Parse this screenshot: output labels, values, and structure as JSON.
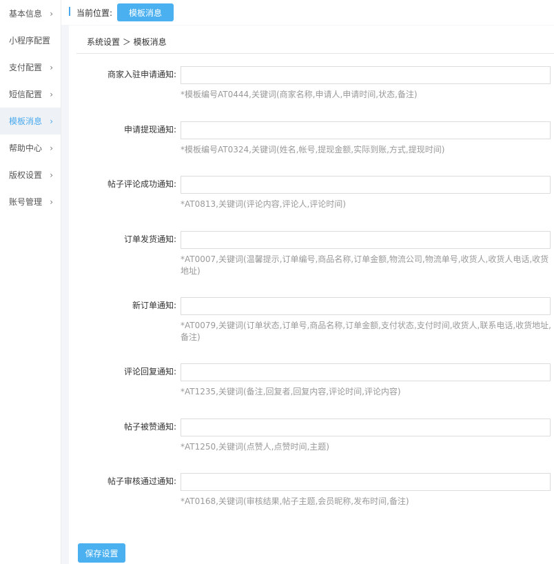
{
  "sidebar": {
    "items": [
      {
        "label": "基本信息",
        "chevron": "›"
      },
      {
        "label": "小程序配置",
        "chevron": ""
      },
      {
        "label": "支付配置",
        "chevron": "›"
      },
      {
        "label": "短信配置",
        "chevron": "›"
      },
      {
        "label": "模板消息",
        "chevron": "›",
        "active": true
      },
      {
        "label": "帮助中心",
        "chevron": "›"
      },
      {
        "label": "版权设置",
        "chevron": "›"
      },
      {
        "label": "账号管理",
        "chevron": "›"
      }
    ]
  },
  "topbar": {
    "location_label": "当前位置:",
    "location_button": "模板消息"
  },
  "breadcrumb": "系统设置 ＞ 模板消息",
  "fields": [
    {
      "label": "商家入驻申请通知:",
      "value": "",
      "hint": "*模板编号AT0444,关键词(商家名称,申请人,申请时间,状态,备注)"
    },
    {
      "label": "申请提现通知:",
      "value": "",
      "hint": "*模板编号AT0324,关键词(姓名,帐号,提现金额,实际到账,方式,提现时间)"
    },
    {
      "label": "帖子评论成功通知:",
      "value": "",
      "hint": "*AT0813,关键词(评论内容,评论人,评论时间)"
    },
    {
      "label": "订单发货通知:",
      "value": "",
      "hint": "*AT0007,关键词(温馨提示,订单编号,商品名称,订单金额,物流公司,物流单号,收货人,收货人电话,收货地址)"
    },
    {
      "label": "新订单通知:",
      "value": "",
      "hint": "*AT0079,关键词(订单状态,订单号,商品名称,订单金额,支付状态,支付时间,收货人,联系电话,收货地址,备注)"
    },
    {
      "label": "评论回复通知:",
      "value": "",
      "hint": "*AT1235,关键词(备注,回复者,回复内容,评论时间,评论内容)"
    },
    {
      "label": "帖子被赞通知:",
      "value": "",
      "hint": "*AT1250,关键词(点赞人,点赞时间,主题)"
    },
    {
      "label": "帖子审核通过通知:",
      "value": "",
      "hint": "*AT0168,关键词(审核结果,帖子主题,会员昵称,发布时间,备注)"
    }
  ],
  "save_button": "保存设置",
  "colors": {
    "accent": "#4ab0f0",
    "active_bg": "#eef2f7",
    "hint": "#999999"
  }
}
